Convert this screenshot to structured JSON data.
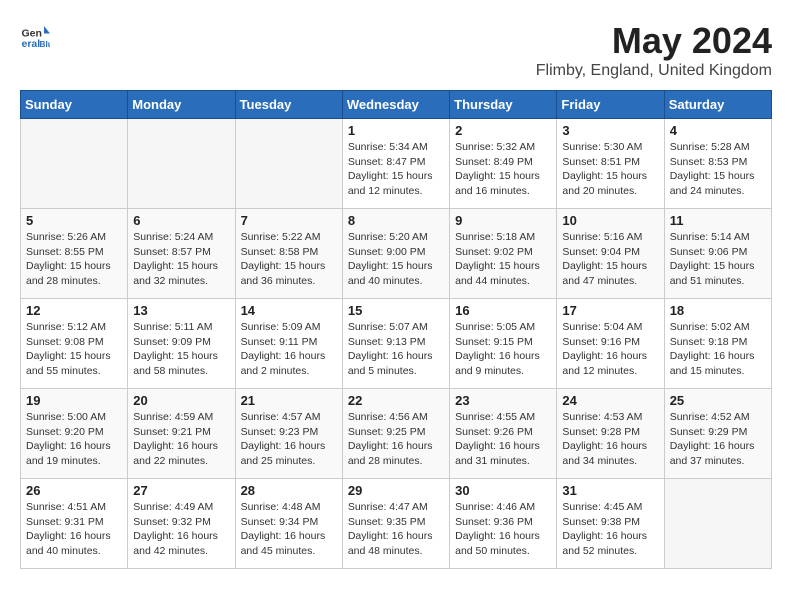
{
  "header": {
    "logo_general": "General",
    "logo_blue": "Blue",
    "month": "May 2024",
    "location": "Flimby, England, United Kingdom"
  },
  "weekdays": [
    "Sunday",
    "Monday",
    "Tuesday",
    "Wednesday",
    "Thursday",
    "Friday",
    "Saturday"
  ],
  "weeks": [
    [
      {
        "day": "",
        "info": ""
      },
      {
        "day": "",
        "info": ""
      },
      {
        "day": "",
        "info": ""
      },
      {
        "day": "1",
        "info": "Sunrise: 5:34 AM\nSunset: 8:47 PM\nDaylight: 15 hours\nand 12 minutes."
      },
      {
        "day": "2",
        "info": "Sunrise: 5:32 AM\nSunset: 8:49 PM\nDaylight: 15 hours\nand 16 minutes."
      },
      {
        "day": "3",
        "info": "Sunrise: 5:30 AM\nSunset: 8:51 PM\nDaylight: 15 hours\nand 20 minutes."
      },
      {
        "day": "4",
        "info": "Sunrise: 5:28 AM\nSunset: 8:53 PM\nDaylight: 15 hours\nand 24 minutes."
      }
    ],
    [
      {
        "day": "5",
        "info": "Sunrise: 5:26 AM\nSunset: 8:55 PM\nDaylight: 15 hours\nand 28 minutes."
      },
      {
        "day": "6",
        "info": "Sunrise: 5:24 AM\nSunset: 8:57 PM\nDaylight: 15 hours\nand 32 minutes."
      },
      {
        "day": "7",
        "info": "Sunrise: 5:22 AM\nSunset: 8:58 PM\nDaylight: 15 hours\nand 36 minutes."
      },
      {
        "day": "8",
        "info": "Sunrise: 5:20 AM\nSunset: 9:00 PM\nDaylight: 15 hours\nand 40 minutes."
      },
      {
        "day": "9",
        "info": "Sunrise: 5:18 AM\nSunset: 9:02 PM\nDaylight: 15 hours\nand 44 minutes."
      },
      {
        "day": "10",
        "info": "Sunrise: 5:16 AM\nSunset: 9:04 PM\nDaylight: 15 hours\nand 47 minutes."
      },
      {
        "day": "11",
        "info": "Sunrise: 5:14 AM\nSunset: 9:06 PM\nDaylight: 15 hours\nand 51 minutes."
      }
    ],
    [
      {
        "day": "12",
        "info": "Sunrise: 5:12 AM\nSunset: 9:08 PM\nDaylight: 15 hours\nand 55 minutes."
      },
      {
        "day": "13",
        "info": "Sunrise: 5:11 AM\nSunset: 9:09 PM\nDaylight: 15 hours\nand 58 minutes."
      },
      {
        "day": "14",
        "info": "Sunrise: 5:09 AM\nSunset: 9:11 PM\nDaylight: 16 hours\nand 2 minutes."
      },
      {
        "day": "15",
        "info": "Sunrise: 5:07 AM\nSunset: 9:13 PM\nDaylight: 16 hours\nand 5 minutes."
      },
      {
        "day": "16",
        "info": "Sunrise: 5:05 AM\nSunset: 9:15 PM\nDaylight: 16 hours\nand 9 minutes."
      },
      {
        "day": "17",
        "info": "Sunrise: 5:04 AM\nSunset: 9:16 PM\nDaylight: 16 hours\nand 12 minutes."
      },
      {
        "day": "18",
        "info": "Sunrise: 5:02 AM\nSunset: 9:18 PM\nDaylight: 16 hours\nand 15 minutes."
      }
    ],
    [
      {
        "day": "19",
        "info": "Sunrise: 5:00 AM\nSunset: 9:20 PM\nDaylight: 16 hours\nand 19 minutes."
      },
      {
        "day": "20",
        "info": "Sunrise: 4:59 AM\nSunset: 9:21 PM\nDaylight: 16 hours\nand 22 minutes."
      },
      {
        "day": "21",
        "info": "Sunrise: 4:57 AM\nSunset: 9:23 PM\nDaylight: 16 hours\nand 25 minutes."
      },
      {
        "day": "22",
        "info": "Sunrise: 4:56 AM\nSunset: 9:25 PM\nDaylight: 16 hours\nand 28 minutes."
      },
      {
        "day": "23",
        "info": "Sunrise: 4:55 AM\nSunset: 9:26 PM\nDaylight: 16 hours\nand 31 minutes."
      },
      {
        "day": "24",
        "info": "Sunrise: 4:53 AM\nSunset: 9:28 PM\nDaylight: 16 hours\nand 34 minutes."
      },
      {
        "day": "25",
        "info": "Sunrise: 4:52 AM\nSunset: 9:29 PM\nDaylight: 16 hours\nand 37 minutes."
      }
    ],
    [
      {
        "day": "26",
        "info": "Sunrise: 4:51 AM\nSunset: 9:31 PM\nDaylight: 16 hours\nand 40 minutes."
      },
      {
        "day": "27",
        "info": "Sunrise: 4:49 AM\nSunset: 9:32 PM\nDaylight: 16 hours\nand 42 minutes."
      },
      {
        "day": "28",
        "info": "Sunrise: 4:48 AM\nSunset: 9:34 PM\nDaylight: 16 hours\nand 45 minutes."
      },
      {
        "day": "29",
        "info": "Sunrise: 4:47 AM\nSunset: 9:35 PM\nDaylight: 16 hours\nand 48 minutes."
      },
      {
        "day": "30",
        "info": "Sunrise: 4:46 AM\nSunset: 9:36 PM\nDaylight: 16 hours\nand 50 minutes."
      },
      {
        "day": "31",
        "info": "Sunrise: 4:45 AM\nSunset: 9:38 PM\nDaylight: 16 hours\nand 52 minutes."
      },
      {
        "day": "",
        "info": ""
      }
    ]
  ]
}
